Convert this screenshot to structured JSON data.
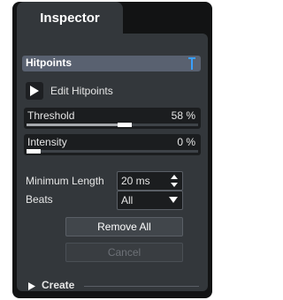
{
  "inspector": {
    "tab_title": "Inspector"
  },
  "hitpoints": {
    "section_title": "Hitpoints",
    "pin_icon": "pin-icon",
    "edit_label": "Edit Hitpoints",
    "edit_tool_icon": "arrow-cursor-icon"
  },
  "threshold": {
    "label": "Threshold",
    "value_text": "58 %",
    "value": 58
  },
  "intensity": {
    "label": "Intensity",
    "value_text": "0 %",
    "value": 0
  },
  "minimum_length": {
    "label": "Minimum Length",
    "value": "20 ms"
  },
  "beats": {
    "label": "Beats",
    "selected": "All"
  },
  "buttons": {
    "remove_all": "Remove All",
    "cancel": "Cancel"
  },
  "create": {
    "label": "Create"
  },
  "colors": {
    "background": "#33373b",
    "section_header": "#596170",
    "accent_blue": "#3aa0ff"
  }
}
